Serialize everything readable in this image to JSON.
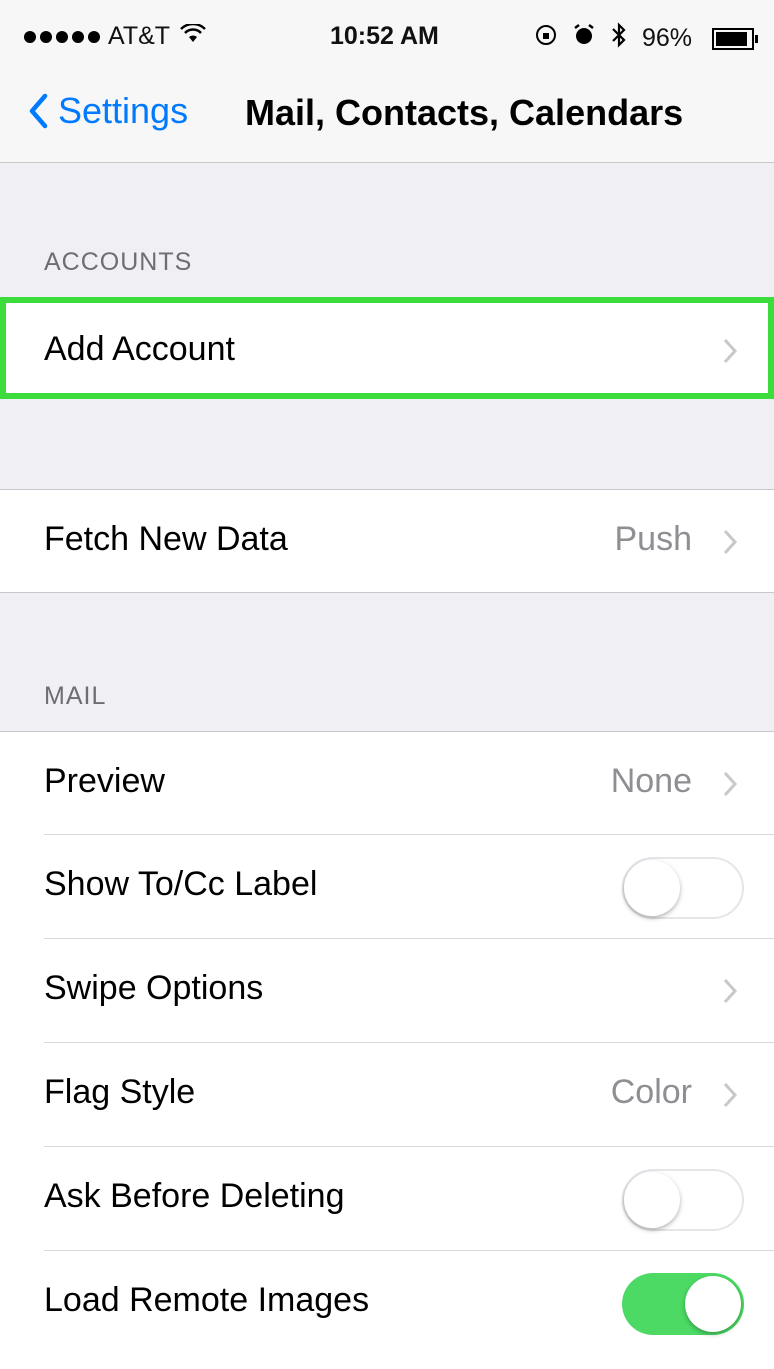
{
  "status_bar": {
    "carrier": "AT&T",
    "time": "10:52 AM",
    "battery": "96%",
    "battery_level": 0.96,
    "icons": [
      "signal-dots-icon",
      "wifi-icon",
      "rotation-lock-icon",
      "alarm-icon",
      "bluetooth-icon",
      "battery-icon"
    ]
  },
  "nav": {
    "back_label": "Settings",
    "title": "Mail, Contacts, Calendars"
  },
  "sections": {
    "accounts_header": "ACCOUNTS",
    "mail_header": "MAIL"
  },
  "cells": {
    "add_account": {
      "label": "Add Account"
    },
    "fetch_new_data": {
      "label": "Fetch New Data",
      "value": "Push"
    },
    "preview": {
      "label": "Preview",
      "value": "None"
    },
    "show_to_cc": {
      "label": "Show To/Cc Label",
      "on": false
    },
    "swipe_options": {
      "label": "Swipe Options"
    },
    "flag_style": {
      "label": "Flag Style",
      "value": "Color"
    },
    "ask_before_deleting": {
      "label": "Ask Before Deleting",
      "on": false
    },
    "load_remote_images": {
      "label": "Load Remote Images",
      "on": true
    }
  },
  "colors": {
    "accent": "#007aff",
    "highlight": "#3ddc3d",
    "toggle_on": "#4cd964",
    "background": "#efeff4"
  }
}
